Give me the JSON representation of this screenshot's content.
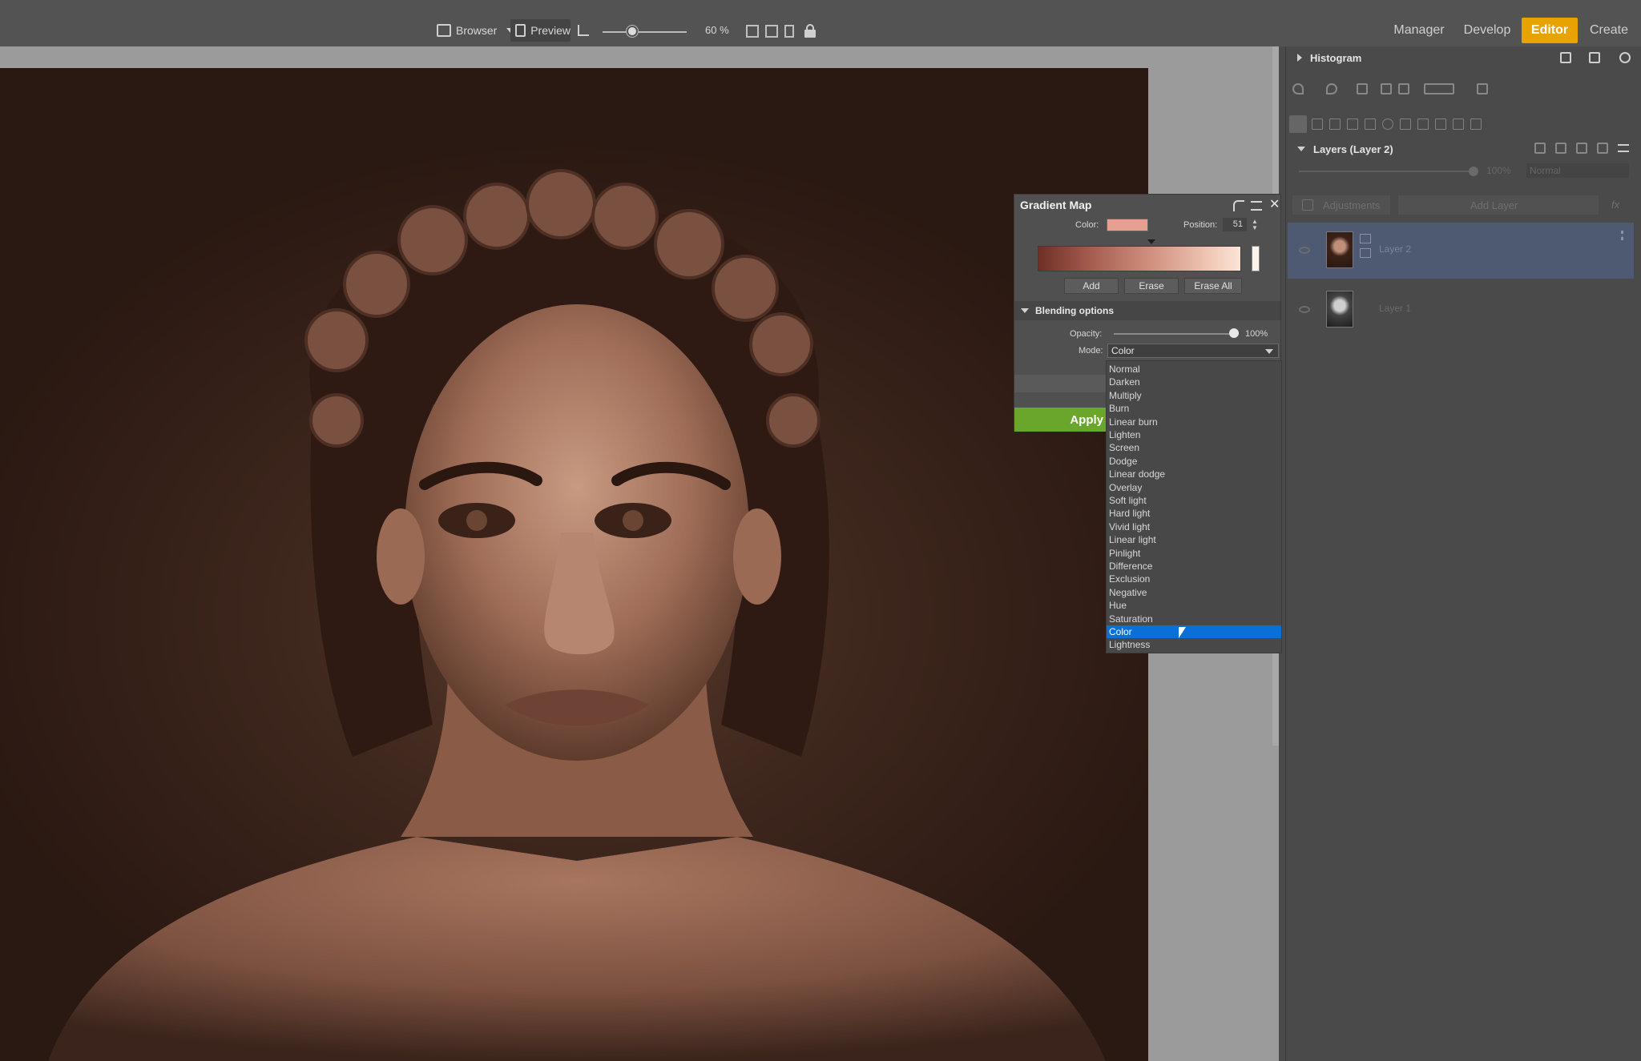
{
  "toolbar": {
    "browser_label": "Browser",
    "preview_label": "Preview",
    "zoom_value": "60 %",
    "zoom_level": 0.35
  },
  "modes": {
    "manager": "Manager",
    "develop": "Develop",
    "editor": "Editor",
    "create": "Create",
    "active": "Editor",
    "accent": "#e8a300"
  },
  "right_panel": {
    "histogram_title": "Histogram",
    "layers_title": "Layers (Layer 2)",
    "layer_opacity": "100%",
    "layer_blend_mode": "Normal",
    "adjustments_label": "Adjustments",
    "add_layer_label": "Add Layer",
    "fx_label": "fx",
    "layers": [
      {
        "name": "Layer 2",
        "selected": true
      },
      {
        "name": "Layer 1",
        "selected": false
      }
    ]
  },
  "gradient_map": {
    "title": "Gradient Map",
    "color_label": "Color:",
    "color_value": "#e6a08f",
    "position_label": "Position:",
    "position_value": "51",
    "add_label": "Add",
    "erase_label": "Erase",
    "erase_all_label": "Erase All",
    "blending_title": "Blending options",
    "opacity_label": "Opacity:",
    "opacity_value": "100%",
    "mode_label": "Mode:",
    "mode_value": "Color",
    "apply_label": "Apply"
  },
  "mode_dropdown": {
    "options": [
      "Normal",
      "Darken",
      "Multiply",
      "Burn",
      "Linear burn",
      "Lighten",
      "Screen",
      "Dodge",
      "Linear dodge",
      "Overlay",
      "Soft light",
      "Hard light",
      "Vivid light",
      "Linear light",
      "Pinlight",
      "Difference",
      "Exclusion",
      "Negative",
      "Hue",
      "Saturation",
      "Color",
      "Lightness"
    ],
    "selected": "Color",
    "highlight_color": "#0a6fd6"
  }
}
